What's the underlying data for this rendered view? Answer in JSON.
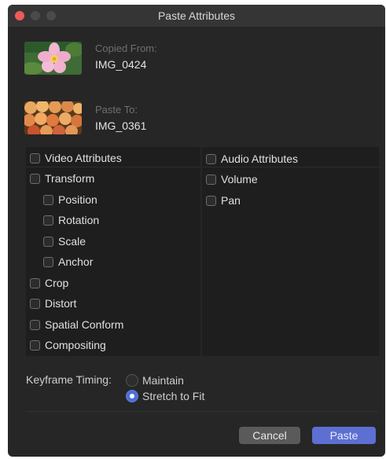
{
  "window": {
    "title": "Paste Attributes"
  },
  "source": {
    "label": "Copied From:",
    "name": "IMG_0424",
    "thumbnail_icon": "flower-thumbnail"
  },
  "target": {
    "label": "Paste To:",
    "name": "IMG_0361",
    "thumbnail_icon": "fruit-thumbnail"
  },
  "video": {
    "header": "Video Attributes",
    "items": [
      {
        "label": "Transform",
        "checked": false
      },
      {
        "label": "Position",
        "checked": false
      },
      {
        "label": "Rotation",
        "checked": false
      },
      {
        "label": "Scale",
        "checked": false
      },
      {
        "label": "Anchor",
        "checked": false
      },
      {
        "label": "Crop",
        "checked": false
      },
      {
        "label": "Distort",
        "checked": false
      },
      {
        "label": "Spatial Conform",
        "checked": false
      },
      {
        "label": "Compositing",
        "checked": false
      }
    ]
  },
  "audio": {
    "header": "Audio Attributes",
    "items": [
      {
        "label": "Volume",
        "checked": false
      },
      {
        "label": "Pan",
        "checked": false
      }
    ]
  },
  "keyframe": {
    "label": "Keyframe Timing:",
    "options": [
      {
        "label": "Maintain",
        "selected": false
      },
      {
        "label": "Stretch to Fit",
        "selected": true
      }
    ]
  },
  "buttons": {
    "cancel": "Cancel",
    "paste": "Paste"
  },
  "colors": {
    "accent": "#5d6fd2",
    "window_bg": "#262626",
    "panel_bg": "#1e1e1e"
  }
}
